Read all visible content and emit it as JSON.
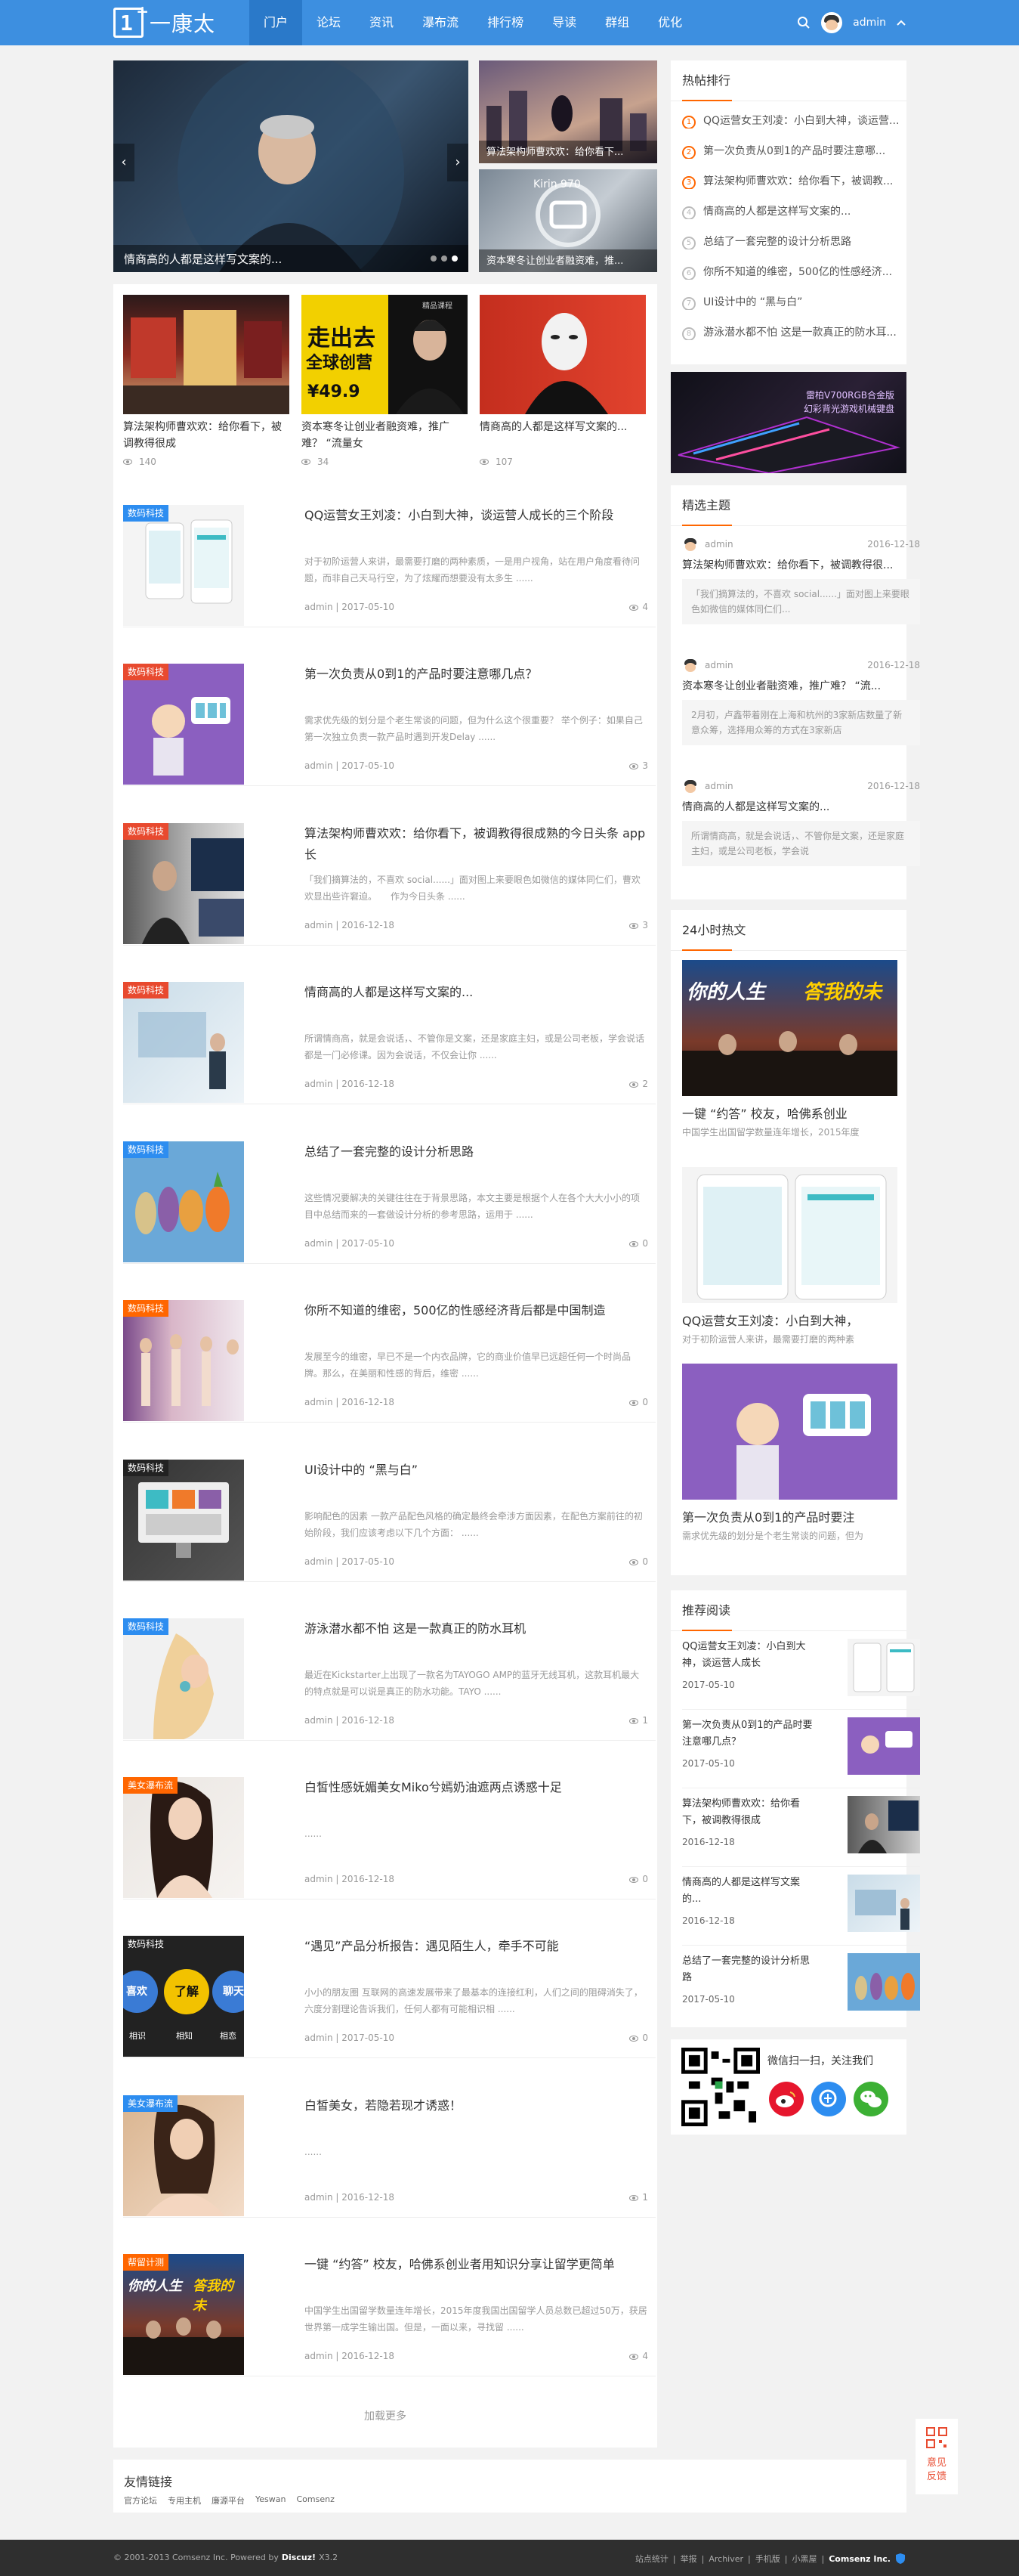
{
  "header": {
    "logo_text": "一康太",
    "nav": [
      "门户",
      "论坛",
      "资讯",
      "瀑布流",
      "排行榜",
      "导读",
      "群组",
      "优化"
    ],
    "user": "admin"
  },
  "slider": {
    "main_caption": "情商高的人都是这样写文案的...",
    "side1_caption": "算法架构师曹欢欢：给你看下...",
    "side2_caption": "资本寒冬让创业者融资难，推...",
    "side2_chip": "Kirin 970"
  },
  "cards": [
    {
      "title": "算法架构师曹欢欢：给你看下，被调教得很成",
      "views": "140"
    },
    {
      "title": "资本寒冬让创业者融资难，推广难？ “流量女",
      "views": "34",
      "poster_line1": "走出去",
      "poster_line2": "全球创营",
      "poster_price": "¥49.9",
      "poster_tag": "精品课程"
    },
    {
      "title": "情商高的人都是这样写文案的...",
      "views": "107"
    }
  ],
  "articles": [
    {
      "tag": "数码科技",
      "title": "QQ运营女王刘凌：小白到大神，谈运营人成长的三个阶段",
      "summary": "对于初阶运营人来讲，最需要打磨的两种素质，一是用户视角，站在用户角度看待问题，而非自己天马行空，为了炫耀而想要没有太多生 ......",
      "meta": "admin | 2017-05-10",
      "views": "4"
    },
    {
      "tag": "数码科技",
      "title": "第一次负责从0到1的产品时要注意哪几点？",
      "summary": "需求优先级的划分是个老生常谈的问题，但为什么这个很重要？ 举个例子：如果自己第一次独立负责一款产品时遇到开发Delay ......",
      "meta": "admin | 2017-05-10",
      "views": "3"
    },
    {
      "tag": "数码科技",
      "title": "算法架构师曹欢欢：给你看下，被调教得很成熟的今日头条 app 长",
      "summary": "「我们摘算法的，不喜欢 social......」面对图上来要眼色如微信的媒体同仁们，曹欢欢显出些许窘迫。　　作为今日头条 ......",
      "meta": "admin | 2016-12-18",
      "views": "3"
    },
    {
      "tag": "数码科技",
      "title": "情商高的人都是这样写文案的...",
      "summary": "所谓情商高，就是会说话，、不管你是文案，还是家庭主妇，或是公司老板，学会说话都是一门必修课。因为会说话，不仅会让你 ......",
      "meta": "admin | 2016-12-18",
      "views": "2"
    },
    {
      "tag": "数码科技",
      "title": "总结了一套完整的设计分析思路",
      "summary": "这些情况要解决的关键往往在于背景思路，本文主要是根据个人在各个大大小小的项目中总结而来的一套做设计分析的参考思路，运用于 ......",
      "meta": "admin | 2017-05-10",
      "views": "0"
    },
    {
      "tag": "数码科技",
      "title": "你所不知道的维密，500亿的性感经济背后都是中国制造",
      "summary": "发展至今的维密，早已不是一个内衣品牌，它的商业价值早已远超任何一个时尚品牌。那么，在美丽和性感的背后，维密 ......",
      "meta": "admin | 2016-12-18",
      "views": "0"
    },
    {
      "tag": "数码科技",
      "title": "UI设计中的 “黑与白”",
      "summary": "影响配色的因素 一款产品配色风格的确定最终会牵涉方面因素，在配色方案前往的初始阶段，我们应该考虑以下几个方面： ......",
      "meta": "admin | 2017-05-10",
      "views": "0"
    },
    {
      "tag": "数码科技",
      "title": "游泳潜水都不怕 这是一款真正的防水耳机",
      "summary": "最近在Kickstarter上出现了一款名为TAYOGO AMP的蓝牙无线耳机，这款耳机最大的特点就是可以说是真正的防水功能。TAYO ......",
      "meta": "admin | 2016-12-18",
      "views": "1"
    },
    {
      "tag": "美女瀑布流",
      "title": "白皙性感妩媚美女Miko兮嫣奶油遮两点诱惑十足",
      "summary": "......",
      "meta": "admin | 2016-12-18",
      "views": "0"
    },
    {
      "tag": "数码科技",
      "title": "“遇见”产品分析报告：遇见陌生人，牵手不可能",
      "summary": "小小的朋友圈 互联网的高速发展带来了最基本的连接红利，人们之间的阻碍消失了，六度分割理论告诉我们，任何人都有可能相识相 ......",
      "meta": "admin | 2017-05-10",
      "views": "0",
      "bubble1": "喜欢",
      "bubble2": "了解",
      "bubble3": "聊天",
      "bl1": "相识",
      "bl2": "相知",
      "bl3": "相恋"
    },
    {
      "tag": "美女瀑布流",
      "title": "白皙美女，若隐若现才诱惑！",
      "summary": "......",
      "meta": "admin | 2016-12-18",
      "views": "1"
    },
    {
      "tag": "帮留计测",
      "title": "一键 “约答” 校友，哈佛系创业者用知识分享让留学更简单",
      "summary": "中国学生出国留学数量连年增长，2015年度我国出国留学人员总数已超过50万，获居世界第一成学生输出国。但是，一面以来，寻找留 ......",
      "meta": "admin | 2016-12-18",
      "views": "4"
    }
  ],
  "load_more": "加载更多",
  "hot_rank": {
    "title": "热帖排行",
    "items": [
      {
        "n": "1",
        "t": "QQ运营女王刘凌：小白到大神，谈运营..."
      },
      {
        "n": "2",
        "t": "第一次负责从0到1的产品时要注意哪..."
      },
      {
        "n": "3",
        "t": "算法架构师曹欢欢：给你看下，被调教..."
      },
      {
        "n": "4",
        "t": "情商高的人都是这样写文案的..."
      },
      {
        "n": "5",
        "t": "总结了一套完整的设计分析思路"
      },
      {
        "n": "6",
        "t": "你所不知道的维密，500亿的性感经济..."
      },
      {
        "n": "7",
        "t": "UI设计中的 “黑与白”"
      },
      {
        "n": "8",
        "t": "游泳潜水都不怕 这是一款真正的防水耳..."
      }
    ]
  },
  "ad_banner": {
    "line1": "雷柏V700RGB合金版",
    "line2": "幻彩背光游戏机械键盘"
  },
  "pick": {
    "title": "精选主题",
    "items": [
      {
        "author": "admin",
        "date": "2016-12-18",
        "title": "算法架构师曹欢欢：给你看下，被调教得很...",
        "summary": "「我们摘算法的，不喜欢 social......」面对图上来要眼色如微信的媒体同仁们..."
      },
      {
        "author": "admin",
        "date": "2016-12-18",
        "title": "资本寒冬让创业者融资难，推广难？ “流...",
        "summary": "2月初，卢鑫带着刚在上海和杭州的3家新店数量了新意众筹，选择用众筹的方式在3家新店"
      },
      {
        "author": "admin",
        "date": "2016-12-18",
        "title": "情商高的人都是这样写文案的...",
        "summary": "所谓情商高，就是会说话，、不管你是文案，还是家庭主妇，或是公司老板，学会说"
      }
    ]
  },
  "hot24": {
    "title": "24小时热文",
    "items": [
      {
        "t": "一键 “约答” 校友，哈佛系创业",
        "s": "中国学生出国留学数量连年增长，2015年度"
      },
      {
        "t": "QQ运营女王刘凌：小白到大神，",
        "s": "对于初阶运营人来讲，最需要打磨的两种素"
      },
      {
        "t": "第一次负责从0到1的产品时要注",
        "s": "需求优先级的划分是个老生常谈的问题，但为"
      }
    ],
    "banner_text1": "你的人生",
    "banner_text2": "答我的未"
  },
  "rec": {
    "title": "推荐阅读",
    "items": [
      {
        "t": "QQ运营女王刘凌：小白到大神，谈运营人成长",
        "d": "2017-05-10"
      },
      {
        "t": "第一次负责从0到1的产品时要注意哪几点？",
        "d": "2017-05-10"
      },
      {
        "t": "算法架构师曹欢欢：给你看下，被调教得很成",
        "d": "2016-12-18"
      },
      {
        "t": "情商高的人都是这样写文案的...",
        "d": "2016-12-18"
      },
      {
        "t": "总结了一套完整的设计分析思路",
        "d": "2017-05-10"
      }
    ]
  },
  "wechat": {
    "text": "微信扫一扫，关注我们"
  },
  "feedback": {
    "label": "意见反馈"
  },
  "links": {
    "title": "友情链接",
    "items": [
      "官方论坛",
      "专用主机",
      "廉源平台",
      "Yeswan",
      "Comsenz"
    ]
  },
  "footer": {
    "left": "© 2001-2013 Comsenz Inc.  Powered by",
    "brand": "Discuz!",
    "ver": "X3.2",
    "right": [
      "站点统计",
      "举报",
      "Archiver",
      "手机版",
      "小黑屋"
    ],
    "company": "Comsenz Inc."
  },
  "colors": {
    "primary": "#3d8fe0",
    "accent": "#ff6600",
    "tag_blue": "#2d8df0",
    "tag_orange": "#ff6600",
    "tag_red": "#e84a2f"
  }
}
